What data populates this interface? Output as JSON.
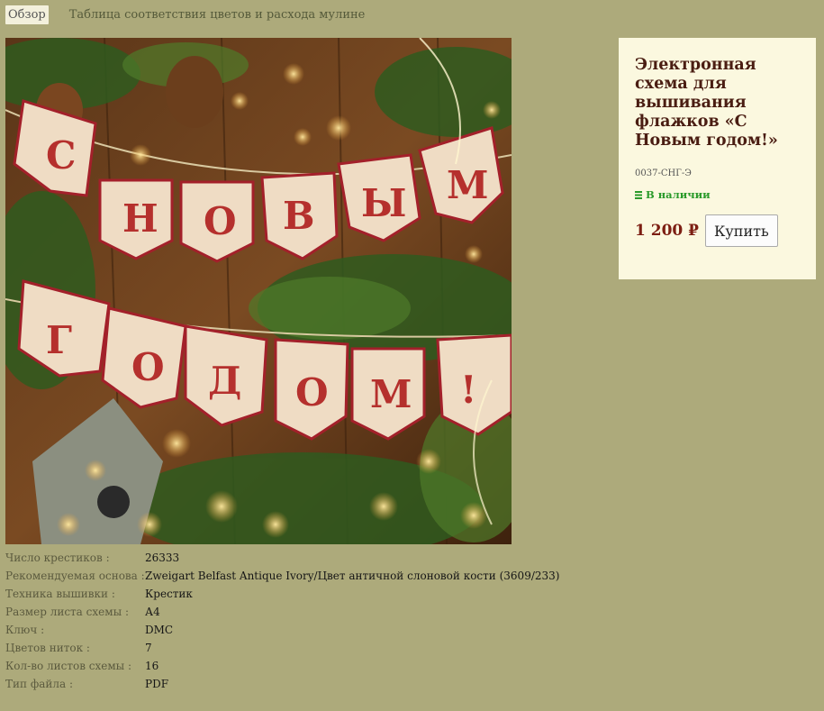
{
  "nav": {
    "tab_overview": "Обзор",
    "tab_colors": "Таблица соответствия цветов и расхода мулине"
  },
  "product": {
    "title": "Электронная схема для вышивания флажков «С Новым годом!»",
    "sku": "0037-СНГ-Э",
    "stock": "В наличии",
    "price": "1 200 ₽",
    "buy_label": "Купить",
    "image_icon": "product-photo"
  },
  "specs": [
    {
      "label": "Число крестиков :",
      "value": "26333"
    },
    {
      "label": "Рекомендуемая основа :",
      "value": "Zweigart Belfast Antique Ivory/Цвет античной слоновой кости (3609/233)"
    },
    {
      "label": "Техника вышивки :",
      "value": "Крестик"
    },
    {
      "label": "Размер листа схемы :",
      "value": "А4"
    },
    {
      "label": "Ключ :",
      "value": "DMC"
    },
    {
      "label": "Цветов ниток :",
      "value": "7"
    },
    {
      "label": "Кол-во листов схемы :",
      "value": "16"
    },
    {
      "label": "Тип файла :",
      "value": "PDF"
    }
  ],
  "colors": {
    "page_bg": "#adaa7b",
    "card_bg": "#fbf8df",
    "title": "#4a1d12",
    "price": "#7c1e12",
    "stock": "#2a9a2a"
  }
}
